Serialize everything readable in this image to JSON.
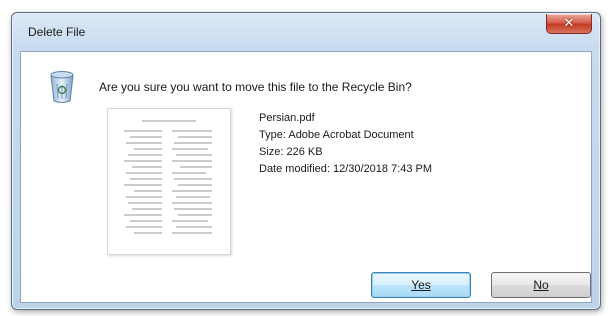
{
  "dialog": {
    "title": "Delete File",
    "close_symbol": "✕",
    "question": "Are you sure you want to move this file to the Recycle Bin?",
    "icon": "recycle-bin-icon",
    "file": {
      "name": "Persian.pdf",
      "type": "Type: Adobe Acrobat Document",
      "size": "Size: 226 KB",
      "date_modified": "Date modified: 12/30/2018 7:43 PM"
    },
    "buttons": {
      "yes": "Yes",
      "no": "No"
    }
  },
  "colors": {
    "accent": "#3c7fb1",
    "close": "#c63a24"
  }
}
